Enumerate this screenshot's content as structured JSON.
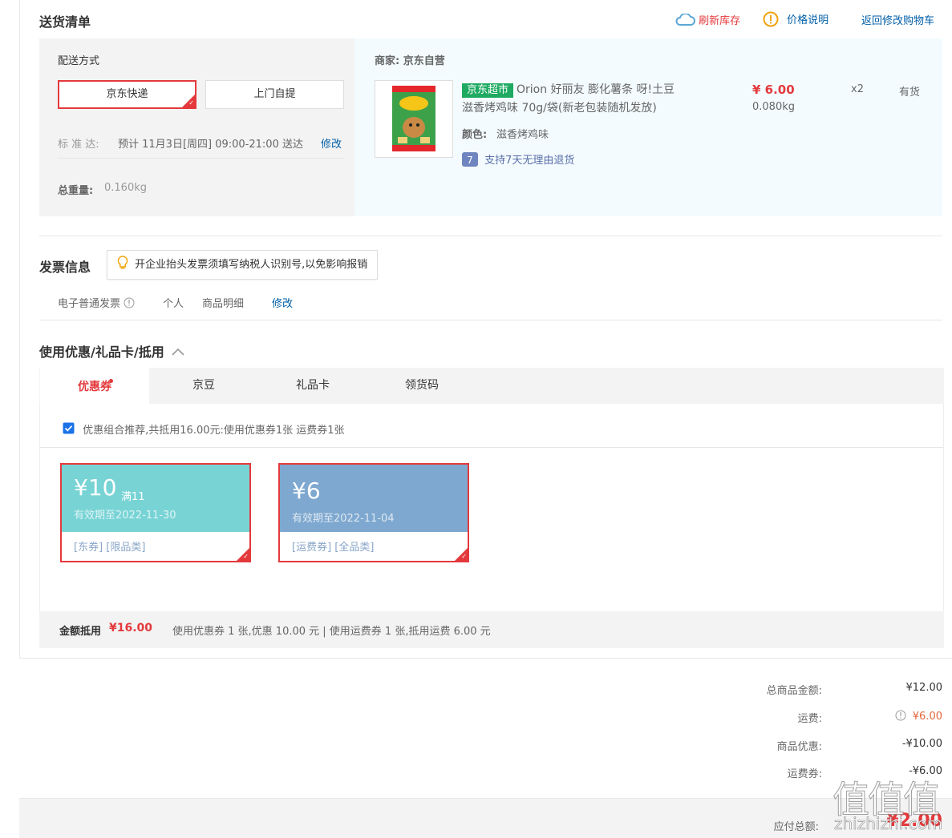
{
  "header": {
    "title": "送货清单",
    "refresh": "刷新库存",
    "price_note": "价格说明",
    "back_to_cart": "返回修改购物车"
  },
  "shipping": {
    "method_label": "配送方式",
    "option_jd": "京东快递",
    "option_pickup": "上门自提",
    "standard_label": "标 准 达:",
    "standard_text": "预计 11月3日[周四] 09:00-21:00 送达",
    "modify": "修改",
    "weight_label": "总重量:",
    "weight_value": "0.160kg"
  },
  "merchant": {
    "label": "商家: 京东自营",
    "product": {
      "tag": "京东超市",
      "name_line1": "Orion 好丽友 膨化薯条 呀!土豆",
      "name_line2": "滋香烤鸡味 70g/袋(新老包装随机发放)",
      "color_label": "颜色:",
      "color_value": "滋香烤鸡味",
      "return_policy": "支持7天无理由退货",
      "price": "¥ 6.00",
      "weight": "0.080kg",
      "qty": "x2",
      "stock": "有货"
    }
  },
  "invoice": {
    "title": "发票信息",
    "tip": "开企业抬头发票须填写纳税人识别号,以免影响报销",
    "type": "电子普通发票",
    "person": "个人",
    "detail": "商品明细",
    "modify": "修改"
  },
  "discount": {
    "title": "使用优惠/礼品卡/抵用",
    "tabs": [
      "优惠券",
      "京豆",
      "礼品卡",
      "领货码"
    ],
    "combo_text": "优惠组合推荐,共抵用16.00元:使用优惠券1张 运费券1张",
    "coupons": [
      {
        "amount": "¥10",
        "cond": "满11",
        "expire": "有效期至2022-11-30",
        "limit": "[东券]  [限品类]",
        "color": "#78d3d5"
      },
      {
        "amount": "¥6",
        "cond": "",
        "expire": "有效期至2022-11-04",
        "limit": "[运费券]  [全品类]",
        "color": "#7ea8cf"
      }
    ],
    "summary_label": "金额抵用",
    "summary_amount": "¥16.00",
    "summary_detail": "使用优惠券 1 张,优惠 10.00 元 | 使用运费券 1 张,抵用运费 6.00 元"
  },
  "totals": {
    "goods_label": "总商品金额:",
    "goods_value": "¥12.00",
    "freight_label": "运费:",
    "freight_value": "¥6.00",
    "promo_label": "商品优惠:",
    "promo_value": "-¥10.00",
    "freight_coupon_label": "运费券:",
    "freight_coupon_value": "-¥6.00",
    "payable_label": "应付总额:",
    "payable_value": "¥2.00"
  },
  "watermark": {
    "text": "值",
    "site": "zhizhizhi.com"
  },
  "colors": {
    "accent": "#e4393c",
    "link": "#005ea7",
    "green": "#1eaa61",
    "orange": "#e4393c"
  }
}
